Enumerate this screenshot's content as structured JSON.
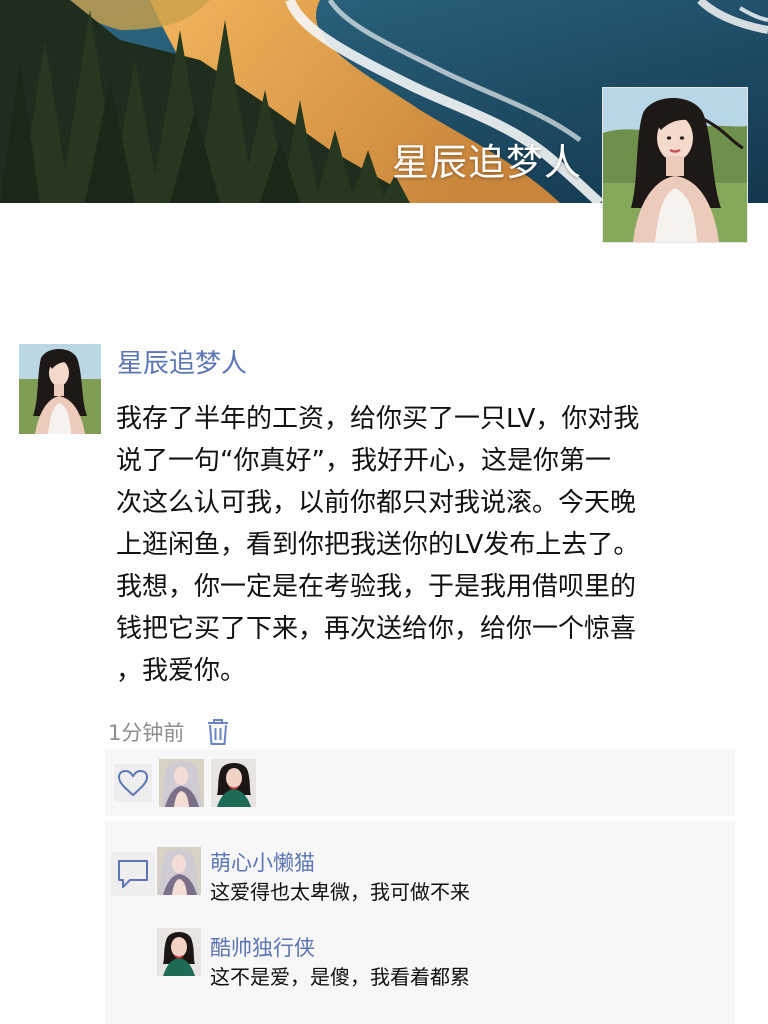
{
  "cover": {
    "name": "星辰追梦人",
    "scene": "forest-beach-ocean"
  },
  "post": {
    "author": "星辰追梦人",
    "lines": [
      "我存了半年的工资，给你买了一只LV，你对我",
      "说了一句“你真好”，我好开心，这是你第一",
      "次这么认可我，以前你都只对我说滚。今天晚",
      "上逛闲鱼，看到你把我送你的LV发布上去了。",
      "我想，你一定是在考验我，于是我用借呗里的",
      "钱把它买了下来，再次送给你，给你一个惊喜",
      "，我爱你。"
    ],
    "time": "1分钟前",
    "delete_icon": "trash-icon"
  },
  "likes": {
    "icon": "heart-icon",
    "users": [
      "萌心小懒猫",
      "酷帅独行侠"
    ]
  },
  "comments": {
    "icon": "comment-bubble-icon",
    "items": [
      {
        "name": "萌心小懒猫",
        "text": "这爱得也太卑微，我可做不来"
      },
      {
        "name": "酷帅独行侠",
        "text": "这不是爱，是傻，我看着都累"
      }
    ]
  },
  "colors": {
    "link_blue": "#5b75b5",
    "panel_bg": "#f7f7f7",
    "meta_gray": "#8d8d8d"
  }
}
